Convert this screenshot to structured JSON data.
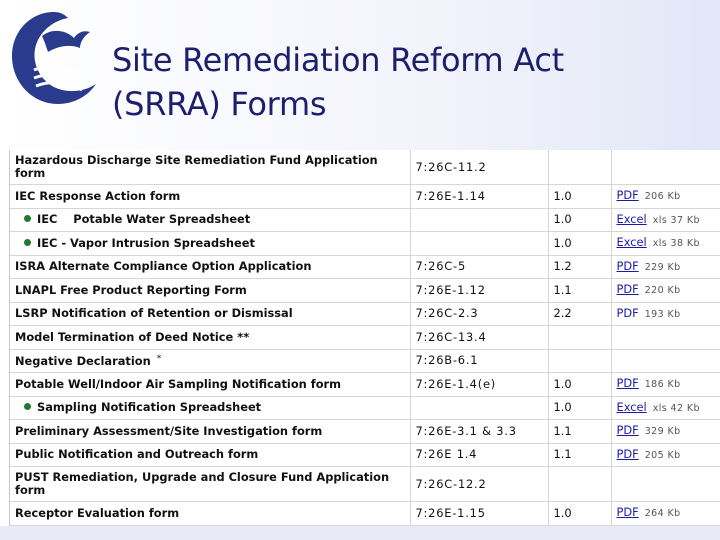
{
  "slide": {
    "title_line1": "Site Remediation Reform Act",
    "title_line2": "(SRRA) Forms",
    "colors": {
      "title": "#1c1f6b",
      "logo": "#2a3a8c",
      "link": "#1a1aa6",
      "bullet": "#1f7a2e"
    },
    "logo_icon": "nj-dep-seal-icon"
  },
  "rows": [
    {
      "form": "Hazardous Discharge Site Remediation Fund Application form",
      "rule": "7:26C-11.2",
      "version": "",
      "doc": "",
      "size": "",
      "tall": true
    },
    {
      "form": "IEC Response Action form",
      "rule": "7:26E-1.14",
      "version": "1.0",
      "doc": "PDF",
      "size": "206 Kb"
    },
    {
      "form": "IEC    Potable Water Spreadsheet",
      "rule": "",
      "version": "1.0",
      "doc": "Excel",
      "size": "xls 37 Kb",
      "sub": true
    },
    {
      "form": "IEC - Vapor Intrusion Spreadsheet",
      "rule": "",
      "version": "1.0",
      "doc": "Excel",
      "size": "xls 38 Kb",
      "sub": true
    },
    {
      "form": "ISRA Alternate Compliance Option Application",
      "rule": "7:26C-5",
      "version": "1.2",
      "doc": "PDF",
      "size": "229 Kb"
    },
    {
      "form": "LNAPL Free Product Reporting Form",
      "rule": "7:26E-1.12",
      "version": "1.1",
      "doc": "PDF",
      "size": "220 Kb"
    },
    {
      "form": "LSRP Notification of Retention or Dismissal",
      "rule": "7:26C-2.3",
      "version": "2.2",
      "doc": "PDF",
      "size": "193 Kb",
      "plain": true
    },
    {
      "form": "Model Termination of Deed Notice **",
      "rule": "7:26C-13.4",
      "version": "",
      "doc": "",
      "size": ""
    },
    {
      "form": "Negative Declaration",
      "star": "*",
      "rule": "7:26B-6.1",
      "version": "",
      "doc": "",
      "size": ""
    },
    {
      "form": "Potable Well/Indoor Air Sampling Notification form",
      "rule": "7:26E-1.4(e)",
      "version": "1.0",
      "doc": "PDF",
      "size": "186 Kb"
    },
    {
      "form": "Sampling Notification Spreadsheet",
      "rule": "",
      "version": "1.0",
      "doc": "Excel",
      "size": "xls 42 Kb",
      "sub": true
    },
    {
      "form": "Preliminary Assessment/Site Investigation form",
      "rule": "7:26E-3.1 & 3.3",
      "version": "1.1",
      "doc": "PDF",
      "size": "329 Kb"
    },
    {
      "form": "Public Notification and Outreach form",
      "rule": "7:26E 1.4",
      "version": "1.1",
      "doc": "PDF",
      "size": "205 Kb"
    },
    {
      "form": "PUST Remediation, Upgrade and Closure Fund Application form",
      "rule": "7:26C-12.2",
      "version": "",
      "doc": "",
      "size": "",
      "tall": true
    },
    {
      "form": "Receptor Evaluation form",
      "rule": "7:26E-1.15",
      "version": "1.0",
      "doc": "PDF",
      "size": "264 Kb"
    }
  ]
}
